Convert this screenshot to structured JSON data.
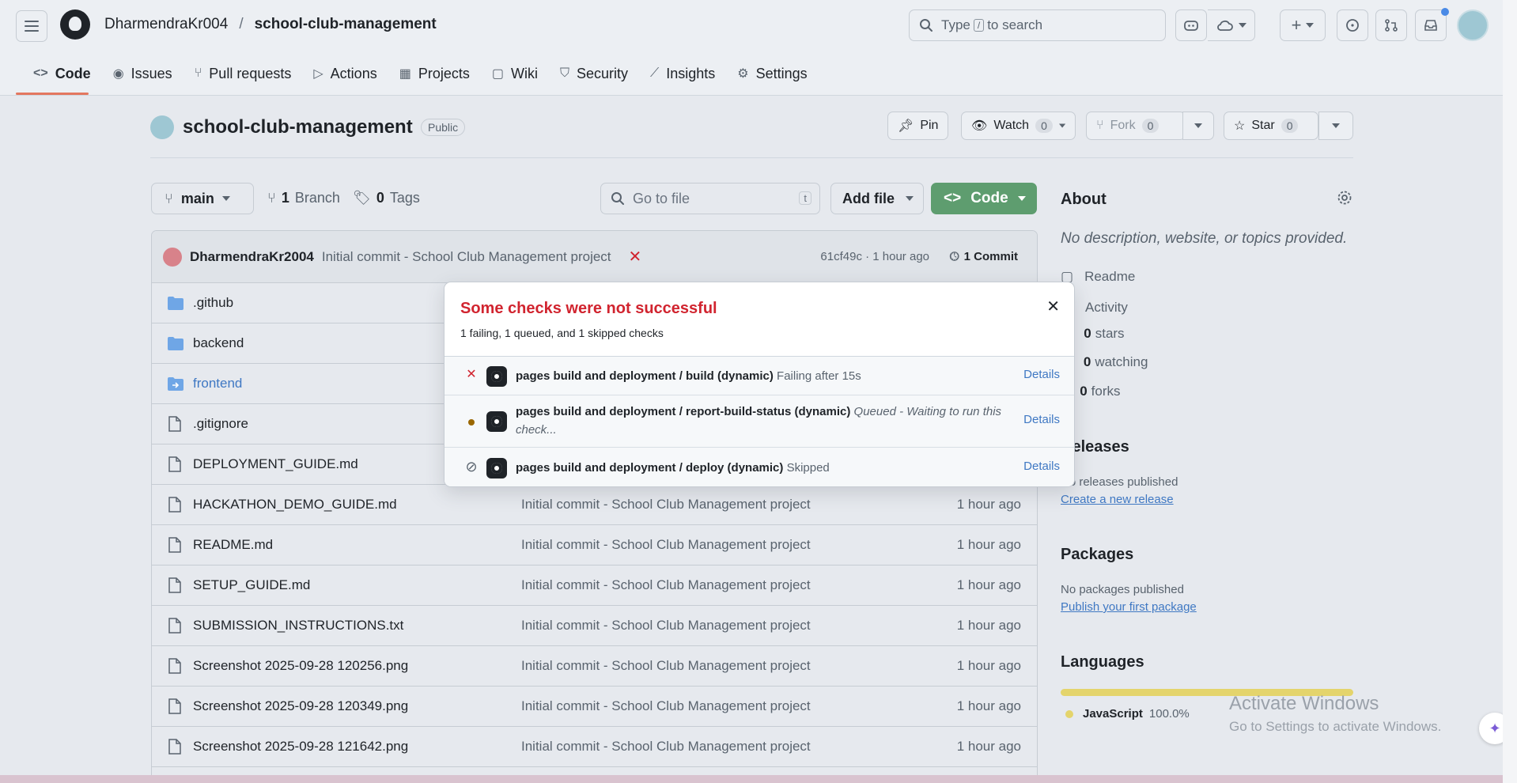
{
  "header": {
    "owner": "DharmendraKr004",
    "separator": "/",
    "repo": "school-club-management",
    "search_prefix": "Type",
    "search_key": "/",
    "search_suffix": "to search"
  },
  "tabs": [
    {
      "label": "Code",
      "icon": "code-icon"
    },
    {
      "label": "Issues",
      "icon": "issue-icon"
    },
    {
      "label": "Pull requests",
      "icon": "pull-request-icon"
    },
    {
      "label": "Actions",
      "icon": "play-icon"
    },
    {
      "label": "Projects",
      "icon": "table-icon"
    },
    {
      "label": "Wiki",
      "icon": "book-icon"
    },
    {
      "label": "Security",
      "icon": "shield-icon"
    },
    {
      "label": "Insights",
      "icon": "graph-icon"
    },
    {
      "label": "Settings",
      "icon": "gear-icon"
    }
  ],
  "repo": {
    "title": "school-club-management",
    "visibility": "Public",
    "pin": "Pin",
    "watch": "Watch",
    "watch_count": "0",
    "fork": "Fork",
    "fork_count": "0",
    "star": "Star",
    "star_count": "0"
  },
  "toolbar": {
    "branch": "main",
    "branches_count": "1",
    "branches_label": "Branch",
    "tags_count": "0",
    "tags_label": "Tags",
    "go_to_file": "Go to file",
    "go_to_file_key": "t",
    "add_file": "Add file",
    "code": "Code"
  },
  "commit": {
    "author": "DharmendraKr2004",
    "message": "Initial commit - School Club Management project",
    "status": "✕",
    "hash_time": "61cf49c · 1 hour ago",
    "count_label": "1 Commit"
  },
  "files": [
    {
      "name": ".github",
      "type": "folder",
      "message": "",
      "age": ""
    },
    {
      "name": "backend",
      "type": "folder",
      "message": "",
      "age": ""
    },
    {
      "name": "frontend",
      "type": "submodule",
      "message": "",
      "age": ""
    },
    {
      "name": ".gitignore",
      "type": "file",
      "message": "",
      "age": ""
    },
    {
      "name": "DEPLOYMENT_GUIDE.md",
      "type": "file",
      "message": "",
      "age": ""
    },
    {
      "name": "HACKATHON_DEMO_GUIDE.md",
      "type": "file",
      "message": "Initial commit - School Club Management project",
      "age": "1 hour ago"
    },
    {
      "name": "README.md",
      "type": "file",
      "message": "Initial commit - School Club Management project",
      "age": "1 hour ago"
    },
    {
      "name": "SETUP_GUIDE.md",
      "type": "file",
      "message": "Initial commit - School Club Management project",
      "age": "1 hour ago"
    },
    {
      "name": "SUBMISSION_INSTRUCTIONS.txt",
      "type": "file",
      "message": "Initial commit - School Club Management project",
      "age": "1 hour ago"
    },
    {
      "name": "Screenshot 2025-09-28 120256.png",
      "type": "file",
      "message": "Initial commit - School Club Management project",
      "age": "1 hour ago"
    },
    {
      "name": "Screenshot 2025-09-28 120349.png",
      "type": "file",
      "message": "Initial commit - School Club Management project",
      "age": "1 hour ago"
    },
    {
      "name": "Screenshot 2025-09-28 121642.png",
      "type": "file",
      "message": "Initial commit - School Club Management project",
      "age": "1 hour ago"
    }
  ],
  "about": {
    "heading": "About",
    "description": "No description, website, or topics provided.",
    "readme": "Readme",
    "activity": "Activity",
    "stars_count": "0",
    "stars_label": "stars",
    "watching_count": "0",
    "watching_label": "watching",
    "forks_count": "0",
    "forks_label": "forks"
  },
  "releases": {
    "heading": "Releases",
    "text": "No releases published",
    "link": "Create a new release"
  },
  "packages": {
    "heading": "Packages",
    "text": "No packages published",
    "link": "Publish your first package"
  },
  "languages": {
    "heading": "Languages",
    "name": "JavaScript",
    "percent": "100.0%",
    "color": "#e4d46c"
  },
  "popover": {
    "title": "Some checks were not successful",
    "summary": "1 failing, 1 queued, and 1 skipped checks",
    "checks": [
      {
        "status": "failing",
        "name": "pages build and deployment / build (dynamic)",
        "state": "Failing after 15s",
        "details": "Details"
      },
      {
        "status": "queued",
        "name": "pages build and deployment / report-build-status (dynamic)",
        "state": "Queued - Waiting to run this check...",
        "details": "Details"
      },
      {
        "status": "skipped",
        "name": "pages build and deployment / deploy (dynamic)",
        "state": "Skipped",
        "details": "Details"
      }
    ]
  },
  "watermark": {
    "line1": "Activate Windows",
    "line2": "Go to Settings to activate Windows."
  },
  "colors": {
    "accent_tab": "#e3775f",
    "code_button": "#5e9d6f",
    "fail_red": "#d1242f",
    "link_blue": "#3f78c3",
    "queued": "#9a6700"
  }
}
